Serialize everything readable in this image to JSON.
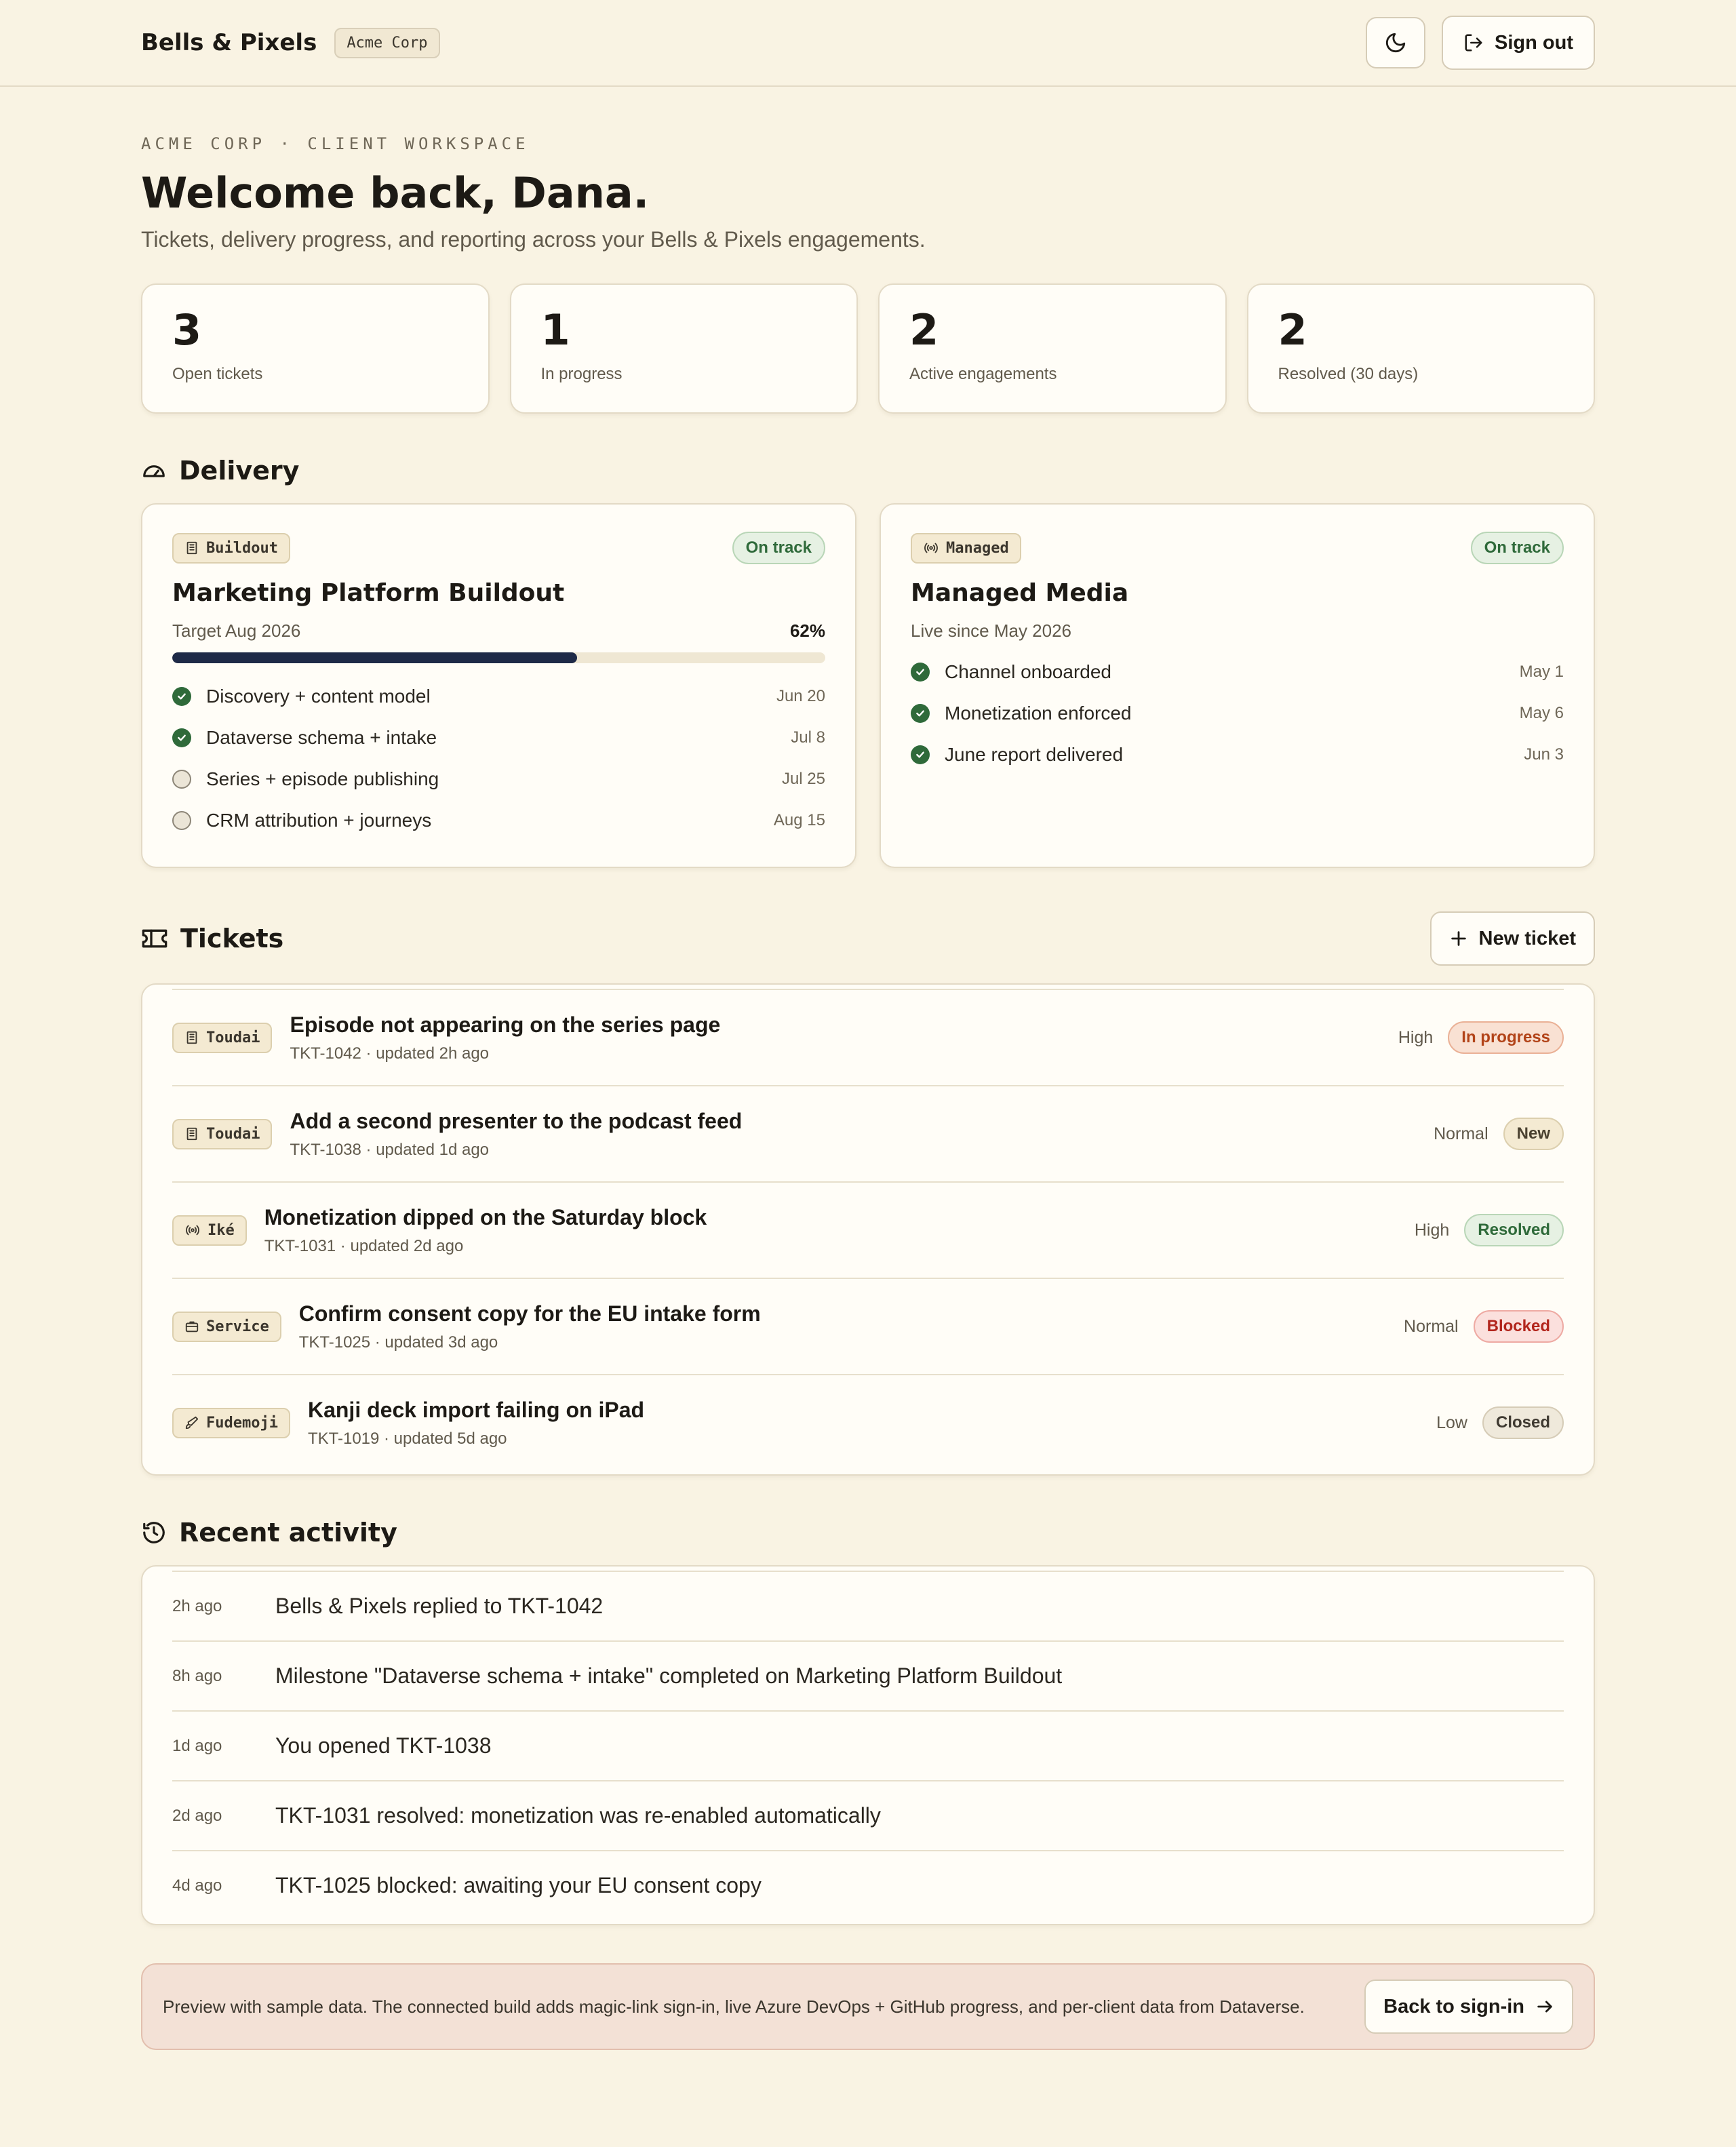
{
  "header": {
    "brand": "Bells & Pixels",
    "org": "Acme Corp",
    "theme_icon": "moon-icon",
    "signout_label": "Sign out"
  },
  "hero": {
    "eyebrow": "ACME CORP · CLIENT WORKSPACE",
    "title": "Welcome back, Dana.",
    "subtitle": "Tickets, delivery progress, and reporting across your Bells & Pixels engagements."
  },
  "stats": [
    {
      "value": "3",
      "label": "Open tickets"
    },
    {
      "value": "1",
      "label": "In progress"
    },
    {
      "value": "2",
      "label": "Active engagements"
    },
    {
      "value": "2",
      "label": "Resolved (30 days)"
    }
  ],
  "delivery": {
    "title": "Delivery",
    "icon": "gauge-icon",
    "engagements": [
      {
        "tag": "Buildout",
        "tag_icon": "building-icon",
        "status": "On track",
        "title": "Marketing Platform Buildout",
        "subtitle": "Target Aug 2026",
        "progress_label": "62%",
        "progress": 0.62,
        "milestones": [
          {
            "name": "Discovery + content model",
            "date": "Jun 20",
            "done": true
          },
          {
            "name": "Dataverse schema + intake",
            "date": "Jul 8",
            "done": true
          },
          {
            "name": "Series + episode publishing",
            "date": "Jul 25",
            "done": false
          },
          {
            "name": "CRM attribution + journeys",
            "date": "Aug 15",
            "done": false
          }
        ]
      },
      {
        "tag": "Managed",
        "tag_icon": "broadcast-icon",
        "status": "On track",
        "title": "Managed Media",
        "subtitle": "Live since May 2026",
        "milestones": [
          {
            "name": "Channel onboarded",
            "date": "May 1",
            "done": true
          },
          {
            "name": "Monetization enforced",
            "date": "May 6",
            "done": true
          },
          {
            "name": "June report delivered",
            "date": "Jun 3",
            "done": true
          }
        ]
      }
    ]
  },
  "tickets": {
    "title": "Tickets",
    "icon": "ticket-icon",
    "new_label": "New ticket",
    "items": [
      {
        "tag": "Toudai",
        "tag_icon": "building-icon",
        "title": "Episode not appearing on the series page",
        "meta": "TKT-1042 · updated 2h ago",
        "priority": "High",
        "status": "In progress",
        "status_color": "#b24318"
      },
      {
        "tag": "Toudai",
        "tag_icon": "building-icon",
        "title": "Add a second presenter to the podcast feed",
        "meta": "TKT-1038 · updated 1d ago",
        "priority": "Normal",
        "status": "New",
        "status_color": "#4a4130"
      },
      {
        "tag": "Iké",
        "tag_icon": "broadcast-icon",
        "title": "Monetization dipped on the Saturday block",
        "meta": "TKT-1031 · updated 2d ago",
        "priority": "High",
        "status": "Resolved",
        "status_color": "#2f6a3a"
      },
      {
        "tag": "Service",
        "tag_icon": "briefcase-icon",
        "title": "Confirm consent copy for the EU intake form",
        "meta": "TKT-1025 · updated 3d ago",
        "priority": "Normal",
        "status": "Blocked",
        "status_color": "#b2251c"
      },
      {
        "tag": "Fudemoji",
        "tag_icon": "brush-icon",
        "title": "Kanji deck import failing on iPad",
        "meta": "TKT-1019 · updated 5d ago",
        "priority": "Low",
        "status": "Closed",
        "status_color": "#3f3a31"
      }
    ]
  },
  "activity": {
    "title": "Recent activity",
    "icon": "history-icon",
    "items": [
      {
        "when": "2h ago",
        "what": "Bells & Pixels replied to TKT-1042"
      },
      {
        "when": "8h ago",
        "what": "Milestone \"Dataverse schema + intake\" completed on Marketing Platform Buildout"
      },
      {
        "when": "1d ago",
        "what": "You opened TKT-1038"
      },
      {
        "when": "2d ago",
        "what": "TKT-1031 resolved: monetization was re-enabled automatically"
      },
      {
        "when": "4d ago",
        "what": "TKT-1025 blocked: awaiting your EU consent copy"
      }
    ]
  },
  "banner": {
    "message": "Preview with sample data. The connected build adds magic-link sign-in, live Azure DevOps + GitHub progress, and per-client data from Dataverse.",
    "back_label": "Back to sign-in"
  }
}
